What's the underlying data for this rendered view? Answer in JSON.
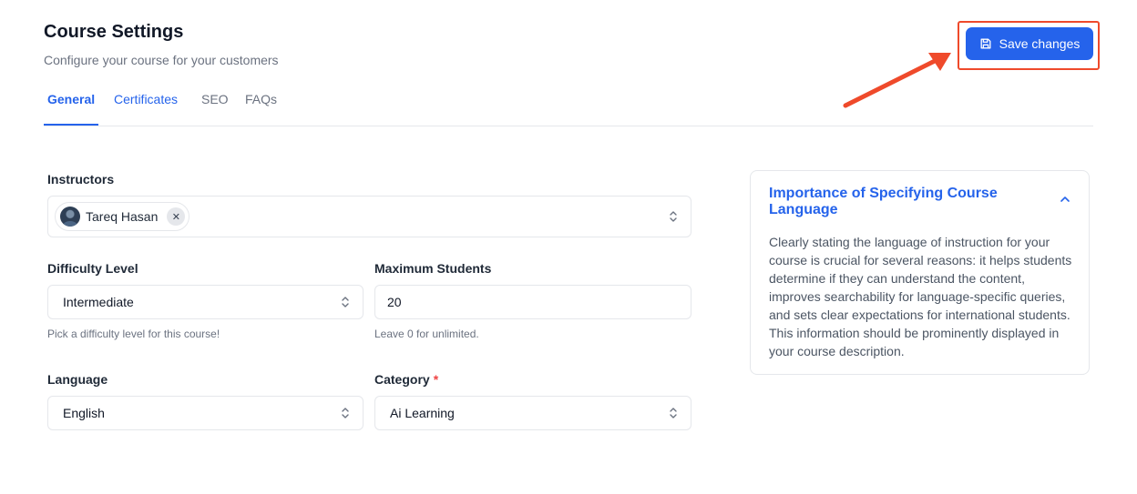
{
  "header": {
    "title": "Course Settings",
    "subtitle": "Configure your course for your customers",
    "save_label": "Save changes"
  },
  "tabs": [
    {
      "label": "General",
      "active": true
    },
    {
      "label": "Certificates",
      "active": false
    },
    {
      "label": "SEO",
      "active": false
    },
    {
      "label": "FAQs",
      "active": false
    }
  ],
  "form": {
    "instructors": {
      "label": "Instructors",
      "selected": [
        {
          "name": "Tareq Hasan"
        }
      ]
    },
    "difficulty": {
      "label": "Difficulty Level",
      "value": "Intermediate",
      "helper": "Pick a difficulty level for this course!"
    },
    "max_students": {
      "label": "Maximum Students",
      "value": "20",
      "helper": "Leave 0 for unlimited."
    },
    "language": {
      "label": "Language",
      "value": "English"
    },
    "category": {
      "label": "Category",
      "required_mark": "*",
      "value": "Ai Learning"
    }
  },
  "info_panel": {
    "title": "Importance of Specifying Course Language",
    "body": "Clearly stating the language of instruction for your course is crucial for several reasons: it helps students determine if they can understand the content, improves searchability for language-specific queries, and sets clear expectations for international students. This information should be prominently displayed in your course description."
  },
  "colors": {
    "accent": "#2563eb",
    "annotation": "#ef4a2b"
  }
}
